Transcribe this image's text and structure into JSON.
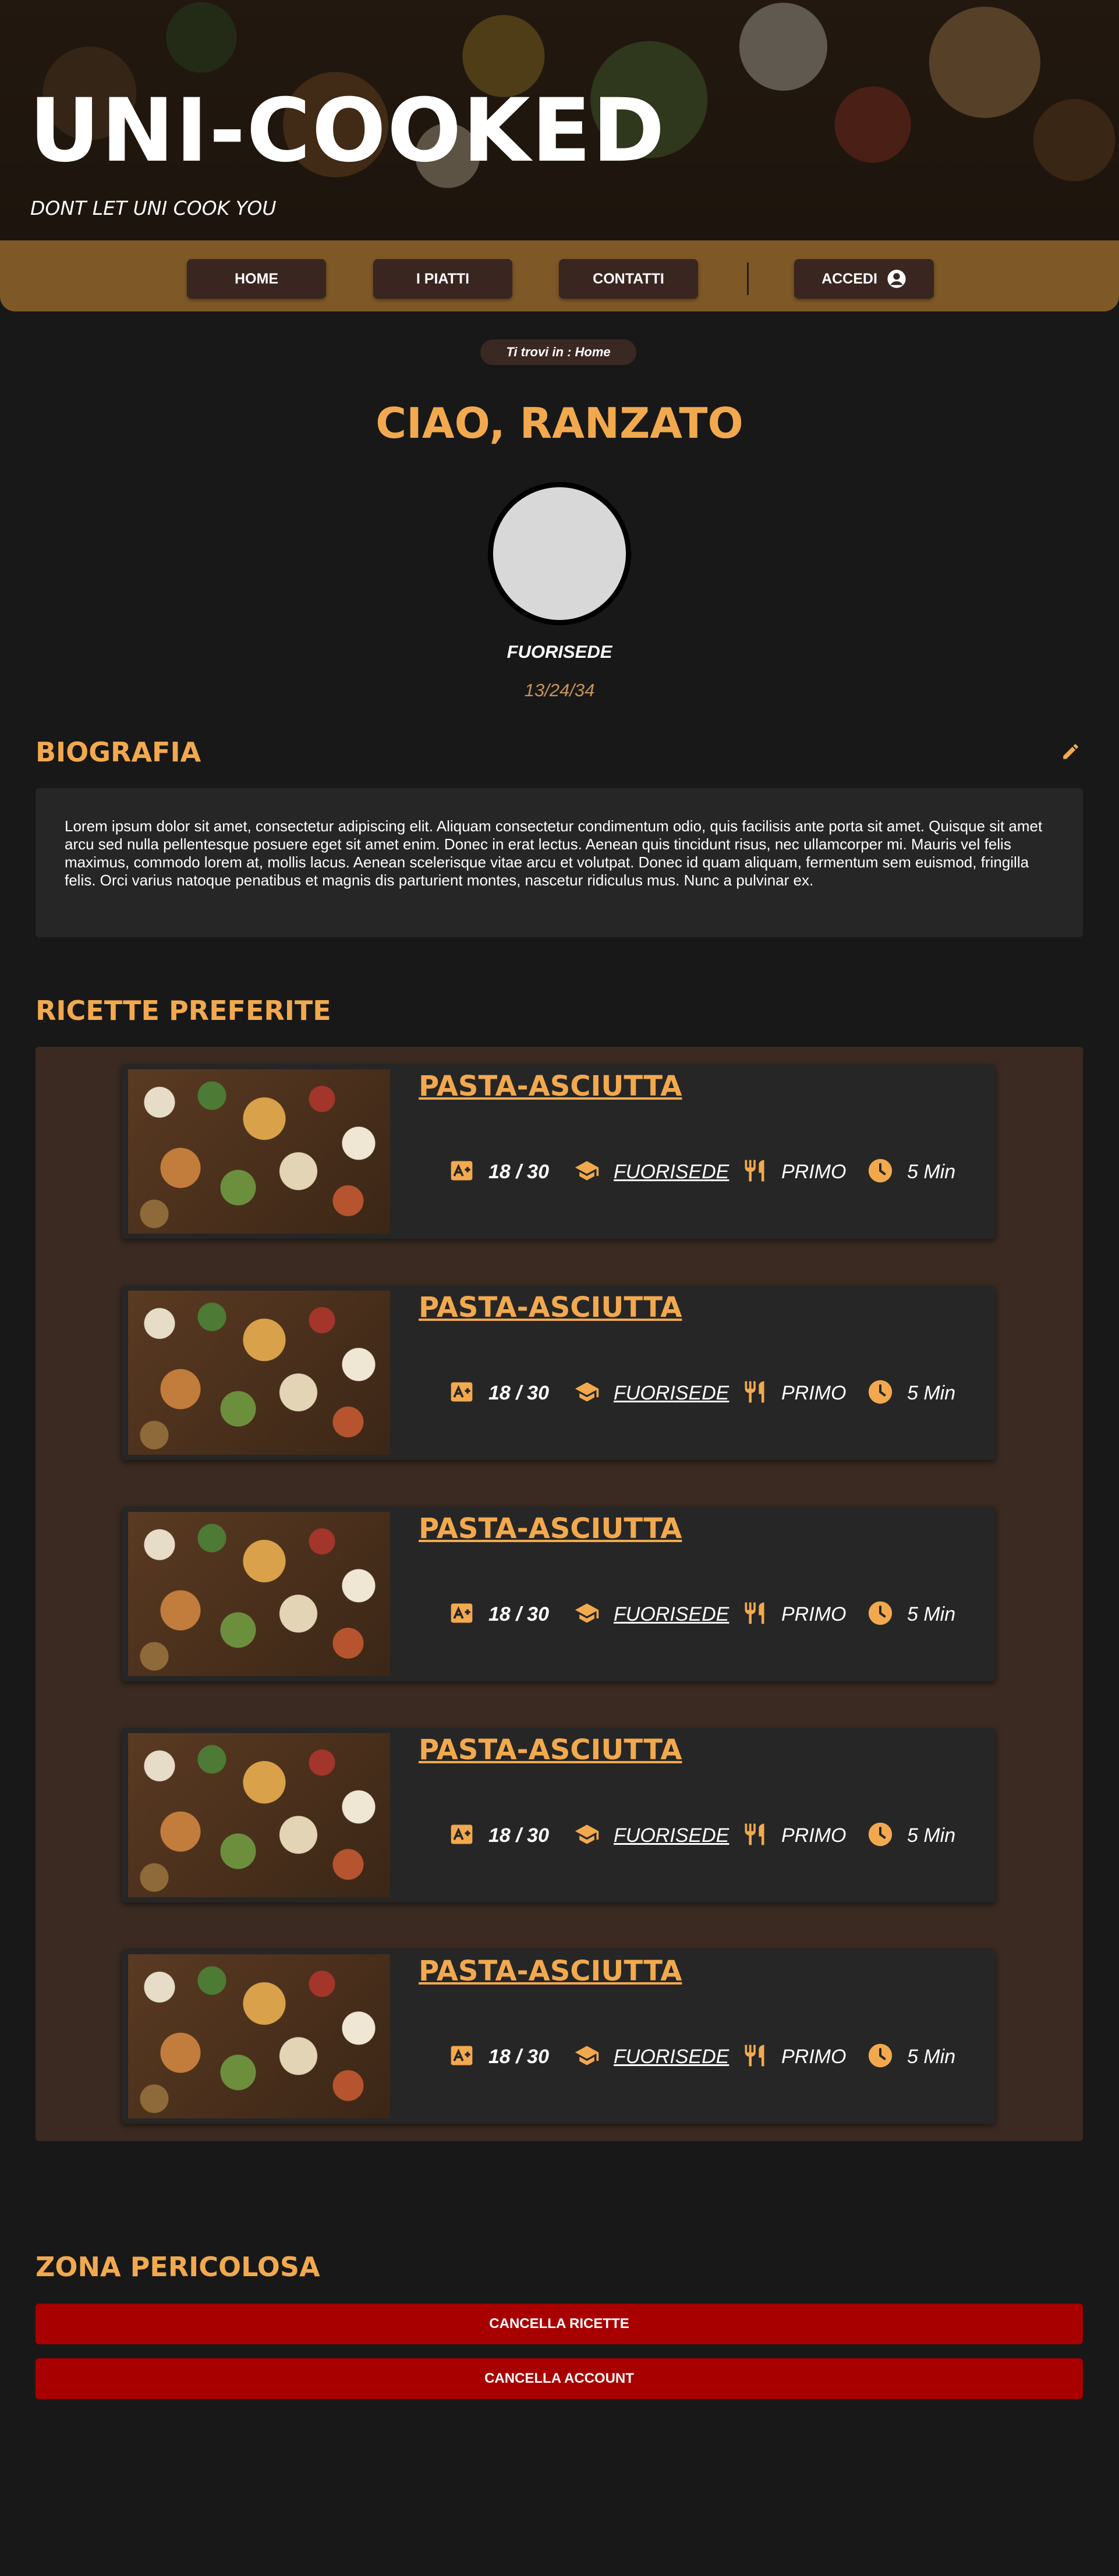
{
  "brand": {
    "title": "UNI-COOKED",
    "tagline": "DONT LET UNI COOK YOU"
  },
  "nav": {
    "items": [
      {
        "label": "HOME"
      },
      {
        "label": "I PIATTI"
      },
      {
        "label": "CONTATTI"
      }
    ],
    "login_label": "ACCEDI",
    "login_icon": "user-circle-icon"
  },
  "breadcrumb": {
    "text": "Ti trovi in : Home"
  },
  "profile": {
    "greeting": "CIAO, RANZATO",
    "user_type": "FUORISEDE",
    "date": "13/24/34"
  },
  "bio": {
    "title": "BIOGRAFIA",
    "edit_icon": "pencil-icon",
    "text": "Lorem ipsum dolor sit amet, consectetur adipiscing elit. Aliquam  consectetur condimentum odio, quis facilisis ante porta sit amet. Quisque sit amet arcu sed nulla pellentesque posuere eget sit amet enim. Donec in erat lectus. Aenean quis tincidunt risus, nec ullamcorper mi.  Mauris vel felis maximus, commodo lorem at, mollis lacus. Aenean  scelerisque vitae arcu et volutpat. Donec id quam aliquam, fermentum sem euismod, fringilla felis. Orci varius natoque penatibus et magnis dis  parturient montes, nascetur ridiculus mus. Nunc a pulvinar ex."
  },
  "favorites": {
    "title": "RICETTE PREFERITE",
    "recipes": [
      {
        "title": "PASTA-ASCIUTTA",
        "grade": "18 / 30",
        "user": "FUORISEDE",
        "course": "PRIMO",
        "time": "5 Min"
      },
      {
        "title": "PASTA-ASCIUTTA",
        "grade": "18 / 30",
        "user": "FUORISEDE",
        "course": "PRIMO",
        "time": "5 Min"
      },
      {
        "title": "PASTA-ASCIUTTA",
        "grade": "18 / 30",
        "user": "FUORISEDE",
        "course": "PRIMO",
        "time": "5 Min"
      },
      {
        "title": "PASTA-ASCIUTTA",
        "grade": "18 / 30",
        "user": "FUORISEDE",
        "course": "PRIMO",
        "time": "5 Min"
      },
      {
        "title": "PASTA-ASCIUTTA",
        "grade": "18 / 30",
        "user": "FUORISEDE",
        "course": "PRIMO",
        "time": "5 Min"
      }
    ]
  },
  "danger": {
    "title": "ZONA PERICOLOSA",
    "delete_recipes_label": "CANCELLA RICETTE",
    "delete_account_label": "CANCELLA ACCOUNT"
  },
  "colors": {
    "accent": "#f2a94e",
    "background": "#181818",
    "danger": "#a80000",
    "card": "#262626"
  }
}
